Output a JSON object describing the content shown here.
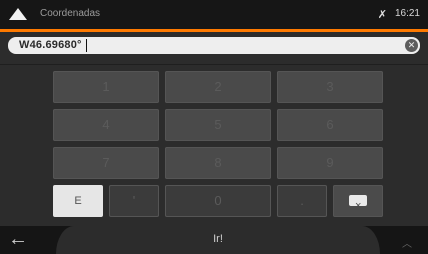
{
  "status_bar": {
    "title": "Coordenadas",
    "time": "16:21",
    "logo_icon": "triangle-logo-icon",
    "gps_icon": "satellite-icon"
  },
  "input": {
    "value": "W46.69680°",
    "clear_icon": "clear-circle-x-icon"
  },
  "keypad": {
    "rows": [
      [
        "1",
        "2",
        "3"
      ],
      [
        "4",
        "5",
        "6"
      ],
      [
        "7",
        "8",
        "9"
      ]
    ],
    "bottom_row": {
      "hemisphere": "E",
      "apostrophe": "'",
      "zero": "0",
      "dot": ".",
      "backspace_icon": "backspace-icon"
    }
  },
  "bottom_bar": {
    "back_icon": "back-arrow-icon",
    "go_label": "Ir!",
    "up_icon": "chevron-up-icon"
  },
  "colors": {
    "accent": "#ff7a00",
    "background": "#2c2c2c",
    "topbar": "#161616"
  }
}
